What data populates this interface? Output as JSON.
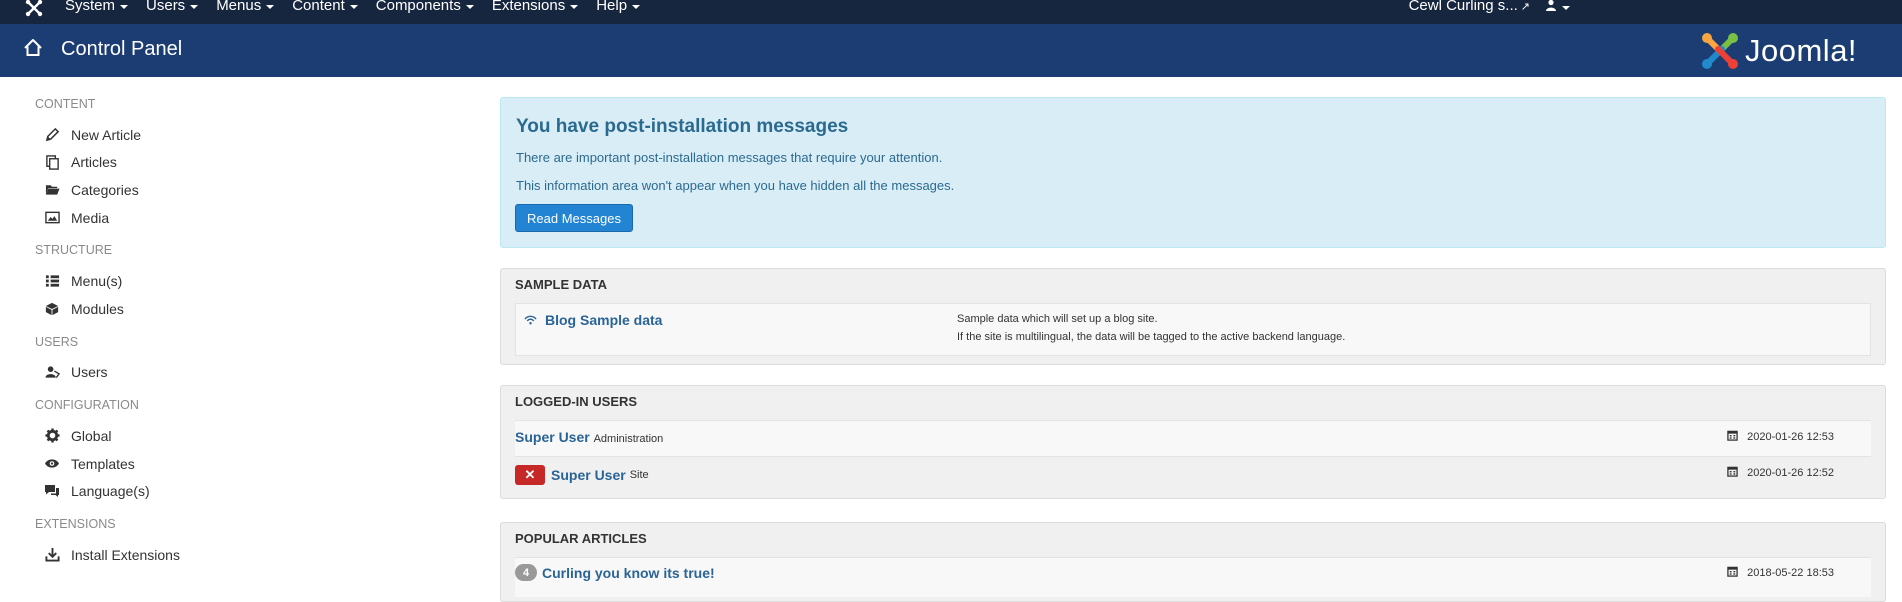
{
  "topnav": {
    "menu": [
      "System",
      "Users",
      "Menus",
      "Content",
      "Components",
      "Extensions",
      "Help"
    ],
    "site_name": "Cewl Curling s..."
  },
  "header": {
    "title": "Control Panel",
    "logo_text": "Joomla!"
  },
  "sidebar": {
    "groups": [
      {
        "heading": "CONTENT",
        "items": [
          {
            "label": "New Article",
            "icon": "pencil-icon"
          },
          {
            "label": "Articles",
            "icon": "copy-icon"
          },
          {
            "label": "Categories",
            "icon": "folder-icon"
          },
          {
            "label": "Media",
            "icon": "image-icon"
          }
        ]
      },
      {
        "heading": "STRUCTURE",
        "items": [
          {
            "label": "Menu(s)",
            "icon": "list-icon"
          },
          {
            "label": "Modules",
            "icon": "cube-icon"
          }
        ]
      },
      {
        "heading": "USERS",
        "items": [
          {
            "label": "Users",
            "icon": "users-icon"
          }
        ]
      },
      {
        "heading": "CONFIGURATION",
        "items": [
          {
            "label": "Global",
            "icon": "cog-icon"
          },
          {
            "label": "Templates",
            "icon": "eye-icon"
          },
          {
            "label": "Language(s)",
            "icon": "comments-icon"
          }
        ]
      },
      {
        "heading": "EXTENSIONS",
        "items": [
          {
            "label": "Install Extensions",
            "icon": "download-icon"
          }
        ]
      }
    ]
  },
  "alert": {
    "title": "You have post-installation messages",
    "line1": "There are important post-installation messages that require your attention.",
    "line2": "This information area won't appear when you have hidden all the messages.",
    "button": "Read Messages"
  },
  "sample_data": {
    "heading": "SAMPLE DATA",
    "item_title": "Blog Sample data",
    "desc1": "Sample data which will set up a blog site.",
    "desc2": "If the site is multilingual, the data will be tagged to the active backend language."
  },
  "logged_in": {
    "heading": "LOGGED-IN USERS",
    "rows": [
      {
        "name": "Super User",
        "client": "Administration",
        "date": "2020-01-26 12:53"
      },
      {
        "name": "Super User",
        "client": "Site",
        "date": "2020-01-26 12:52"
      }
    ]
  },
  "popular": {
    "heading": "POPULAR ARTICLES",
    "rows": [
      {
        "hits": "4",
        "title": "Curling you know its true!",
        "date": "2018-05-22 18:53"
      }
    ]
  },
  "colors": {
    "topnav_bg": "#17263f",
    "header_bg": "#1c3d73",
    "link": "#2a6496",
    "alert_bg": "#d9edf7",
    "primary_button": "#2384d3",
    "danger": "#c52827"
  }
}
